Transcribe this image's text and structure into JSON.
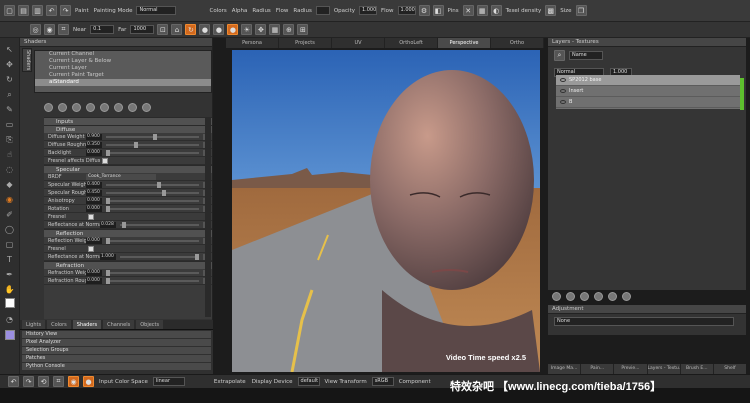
{
  "toolbar": {
    "paint_label": "Paint",
    "mode_label": "Painting Mode",
    "mode_value": "Normal",
    "colors_label": "Colors",
    "alpha_label": "Alpha",
    "radius_label": "Radius",
    "flow_label": "Flow",
    "radius2_label": "Radius",
    "opacity_label": "Opacity",
    "opacity_value": "1.000",
    "flow2_label": "Flow",
    "flow2_value": "1.000",
    "pins_label": "Pins",
    "texel_label": "Texel density",
    "size_label": "Size"
  },
  "toolbar2": {
    "near_label": "Near",
    "near_value": "0.1",
    "far_label": "Far",
    "far_value": "1000"
  },
  "shaders_panel": {
    "title": "Shaders",
    "side_tab": "Shaders",
    "list": [
      "Current Channel",
      "Current Layer & Below",
      "Current Layer",
      "Current Paint Target",
      "aiStandard"
    ],
    "sections": [
      {
        "name": "Inputs"
      },
      {
        "name": "Diffuse"
      }
    ],
    "props": [
      {
        "label": "Diffuse Weight",
        "value": "0.900",
        "knob": 0.5
      },
      {
        "label": "Diffuse Roughness",
        "value": "0.350",
        "knob": 0.3
      }
    ],
    "backlight": {
      "label": "Backlight",
      "value": "0.000"
    },
    "fresnel_diffuse": "Fresnel affects Diffuse",
    "specular_section": "Specular",
    "brdf_label": "BRDF",
    "brdf_value": "Cook_Torrance",
    "spec_props": [
      {
        "label": "Specular Weight",
        "value": "0.400",
        "knob": 0.55
      },
      {
        "label": "Specular Roughness",
        "value": "0.450",
        "knob": 0.6
      },
      {
        "label": "Anisotropy",
        "value": "0.000",
        "knob": 0.0
      },
      {
        "label": "Rotation",
        "value": "0.000",
        "knob": 0.0
      }
    ],
    "fresnel_label": "Fresnel",
    "refl_normal": {
      "label": "Reflectance at Normal",
      "value": "0.028"
    },
    "reflection_section": "Reflection",
    "refl_weight": {
      "label": "Reflection Weight",
      "value": "0.000"
    },
    "fresnel2": "Fresnel",
    "refl_normal2": {
      "label": "Reflectance at Normal",
      "value": "1.000"
    },
    "refraction_section": "Refraction",
    "refr_weight": {
      "label": "Refraction Weight",
      "value": "0.000"
    },
    "refr_rough": {
      "label": "Refraction Roughness",
      "value": "0.000"
    }
  },
  "bottom_tabs": [
    "Lights",
    "Colors",
    "Shaders",
    "Channels",
    "Objects"
  ],
  "active_bottom_tab": "Shaders",
  "palettes": [
    "History View",
    "Pixel Analyzer",
    "Selection Groups",
    "Patches",
    "Python Console"
  ],
  "view_tabs": [
    "Persona",
    "Projects",
    "UV",
    "OrthoLeft",
    "Perspective",
    "Ortho"
  ],
  "active_view": "Perspective",
  "viewport_label": "Video Time speed x2.5",
  "layers_panel": {
    "title": "Layers - Textures",
    "name_label": "Name",
    "blend": "Normal",
    "opacity": "1.000",
    "layers": [
      "SP2012 base",
      "Insert",
      "B"
    ]
  },
  "adjustment_panel": {
    "title": "Adjustment",
    "value": "None"
  },
  "right_tabs": [
    "Image Ma...",
    "Pain...",
    "Previe...",
    "Layers - Textu...",
    "Brush E...",
    "Shelf"
  ],
  "status": {
    "extrapolate": "Extrapolate",
    "display_device": "Display Device",
    "device_value": "default",
    "view_transform": "View Transform",
    "transform_value": "sRGB",
    "component": "Component",
    "input_space": "Input Color Space",
    "input_value": "linear"
  },
  "watermark": "特效杂吧 【www.linecg.com/tieba/1756】",
  "colors": {
    "accent": "#d2691e",
    "viewport_sky": "#3e7ec8",
    "green": "#5ec02e"
  }
}
